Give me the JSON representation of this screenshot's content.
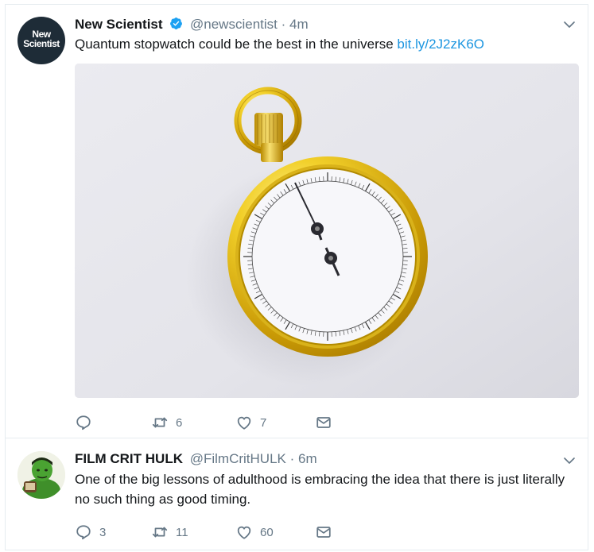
{
  "tweets": [
    {
      "avatar_text_line1": "New",
      "avatar_text_line2": "Scientist",
      "display_name": "New Scientist",
      "verified_icon": "verified-badge-icon",
      "handle": "@newscientist",
      "separator": "·",
      "time": "4m",
      "text": "Quantum stopwatch could be the best in the universe",
      "link": "bit.ly/2J2zK6O",
      "media": "stopwatch-photo",
      "actions": {
        "reply_count": "",
        "retweet_count": "6",
        "like_count": "7"
      }
    },
    {
      "avatar": "hulk-avatar",
      "display_name": "FILM CRIT HULK",
      "handle": "@FilmCritHULK",
      "separator": "·",
      "time": "6m",
      "text": "One of the big lessons of adulthood is embracing the idea that there is just literally no such thing as good timing.",
      "actions": {
        "reply_count": "3",
        "retweet_count": "11",
        "like_count": "60"
      }
    }
  ],
  "colors": {
    "link": "#1b95e0",
    "secondary_text": "#657786",
    "primary_text": "#14171a",
    "verified": "#1da1f2",
    "border": "#e6ecf0"
  },
  "icons": {
    "reply": "reply-icon",
    "retweet": "retweet-icon",
    "like": "heart-icon",
    "dm": "envelope-icon",
    "more": "chevron-down-icon"
  }
}
